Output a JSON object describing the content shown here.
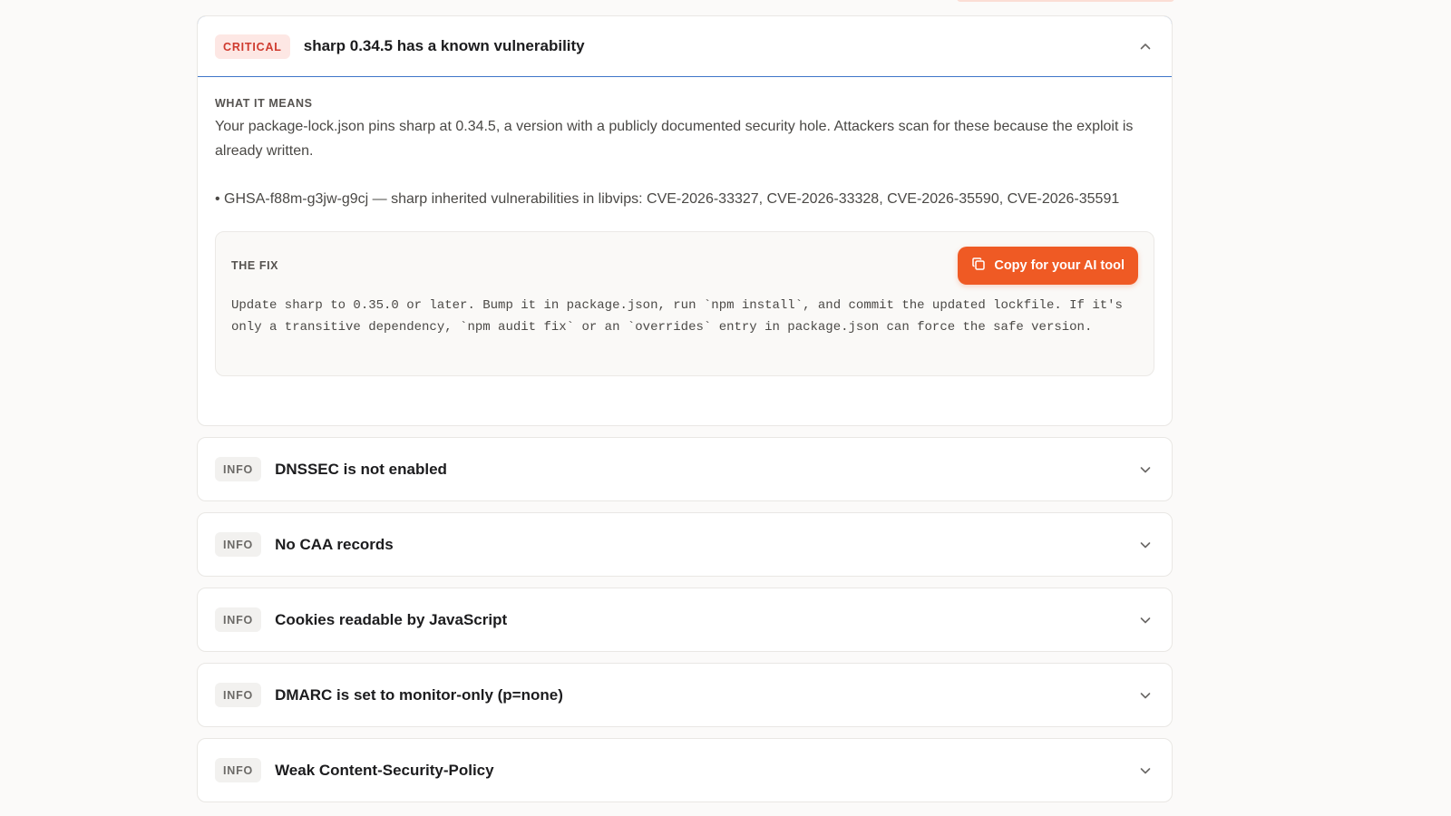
{
  "accent_color": "#ef5a24",
  "findings": [
    {
      "severity": "CRITICAL",
      "title": "sharp 0.34.5 has a known vulnerability",
      "expanded": true,
      "what_it_means_label": "WHAT IT MEANS",
      "description": "Your package-lock.json pins sharp at 0.34.5, a version with a publicly documented security hole. Attackers scan for these because the exploit is already written.",
      "advisory": "• GHSA-f88m-g3jw-g9cj — sharp inherited vulnerabilities in libvips: CVE-2026-33327, CVE-2026-33328, CVE-2026-35590, CVE-2026-35591",
      "fix_label": "THE FIX",
      "copy_button_label": "Copy for your AI tool",
      "fix_text": "Update sharp to 0.35.0 or later. Bump it in package.json, run `npm install`, and commit the updated lockfile. If it's only a transitive dependency, `npm audit fix` or an `overrides` entry in package.json can force the safe version."
    },
    {
      "severity": "INFO",
      "title": "DNSSEC is not enabled"
    },
    {
      "severity": "INFO",
      "title": "No CAA records"
    },
    {
      "severity": "INFO",
      "title": "Cookies readable by JavaScript"
    },
    {
      "severity": "INFO",
      "title": "DMARC is set to monitor-only (p=none)"
    },
    {
      "severity": "INFO",
      "title": "Weak Content-Security-Policy"
    }
  ],
  "icons": {
    "collapse": "chevron-up-icon",
    "expand": "chevron-down-icon",
    "copy": "copy-icon"
  }
}
